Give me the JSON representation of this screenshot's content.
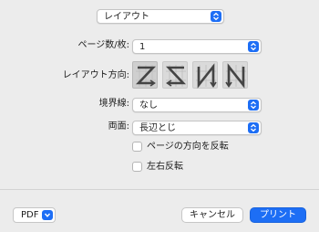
{
  "section_popup": {
    "value": "レイアウト"
  },
  "pages_per_sheet": {
    "label": "ページ数/枚:",
    "value": "1"
  },
  "layout_direction": {
    "label": "レイアウト方向:"
  },
  "border": {
    "label": "境界線:",
    "value": "なし"
  },
  "two_sided": {
    "label": "両面:",
    "value": "長辺とじ"
  },
  "checkboxes": [
    {
      "label": "ページの方向を反転",
      "checked": false
    },
    {
      "label": "左右反転",
      "checked": false
    }
  ],
  "footer": {
    "pdf_label": "PDF",
    "cancel_label": "キャンセル",
    "print_label": "プリント"
  },
  "colors": {
    "accent": "#1d6ef5",
    "background": "#ececec"
  },
  "icons": [
    "chevron-updown-icon",
    "layout-z-icon",
    "layout-reverse-z-icon",
    "layout-n-icon",
    "layout-reverse-n-icon",
    "chevron-down-icon"
  ]
}
